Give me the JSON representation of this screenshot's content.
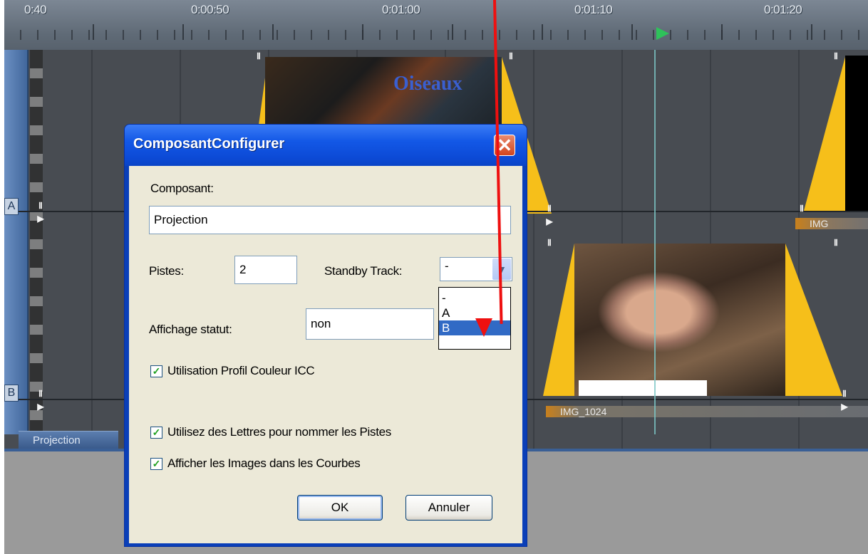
{
  "ruler": {
    "labels": [
      "0:40",
      "0:00:50",
      "0:01:00",
      "0:01:10",
      "0:01:20"
    ]
  },
  "tracks": {
    "letters": [
      "A",
      "B"
    ],
    "title_text": "Oiseaux",
    "clips": [
      "IMG",
      "IMG_1024"
    ],
    "marker_glyph": "Ⅱ",
    "play_glyph": "▶"
  },
  "panel_tab": "Projection",
  "dialog": {
    "title": "ComposantConfigurer",
    "close_glyph": "✕",
    "composant_label": "Composant:",
    "composant_value": "Projection",
    "pistes_label": "Pistes:",
    "pistes_value": "2",
    "standby_label": "Standby Track:",
    "standby_value": "-",
    "standby_options": [
      "-",
      "A",
      "B"
    ],
    "standby_highlighted": "B",
    "affichage_label": "Affichage statut:",
    "affichage_value": "non",
    "checkboxes": [
      {
        "label": "Utilisation Profil Couleur ICC",
        "checked": true
      },
      {
        "label": "Utilisez des Lettres pour nommer les Pistes",
        "checked": true
      },
      {
        "label": "Afficher les Images dans les Courbes",
        "checked": true
      }
    ],
    "ok_label": "OK",
    "cancel_label": "Annuler"
  },
  "colors": {
    "accent": "#316ac5",
    "annotation_arrow": "#ee1010",
    "clip_yellow": "#f6bf1a"
  }
}
